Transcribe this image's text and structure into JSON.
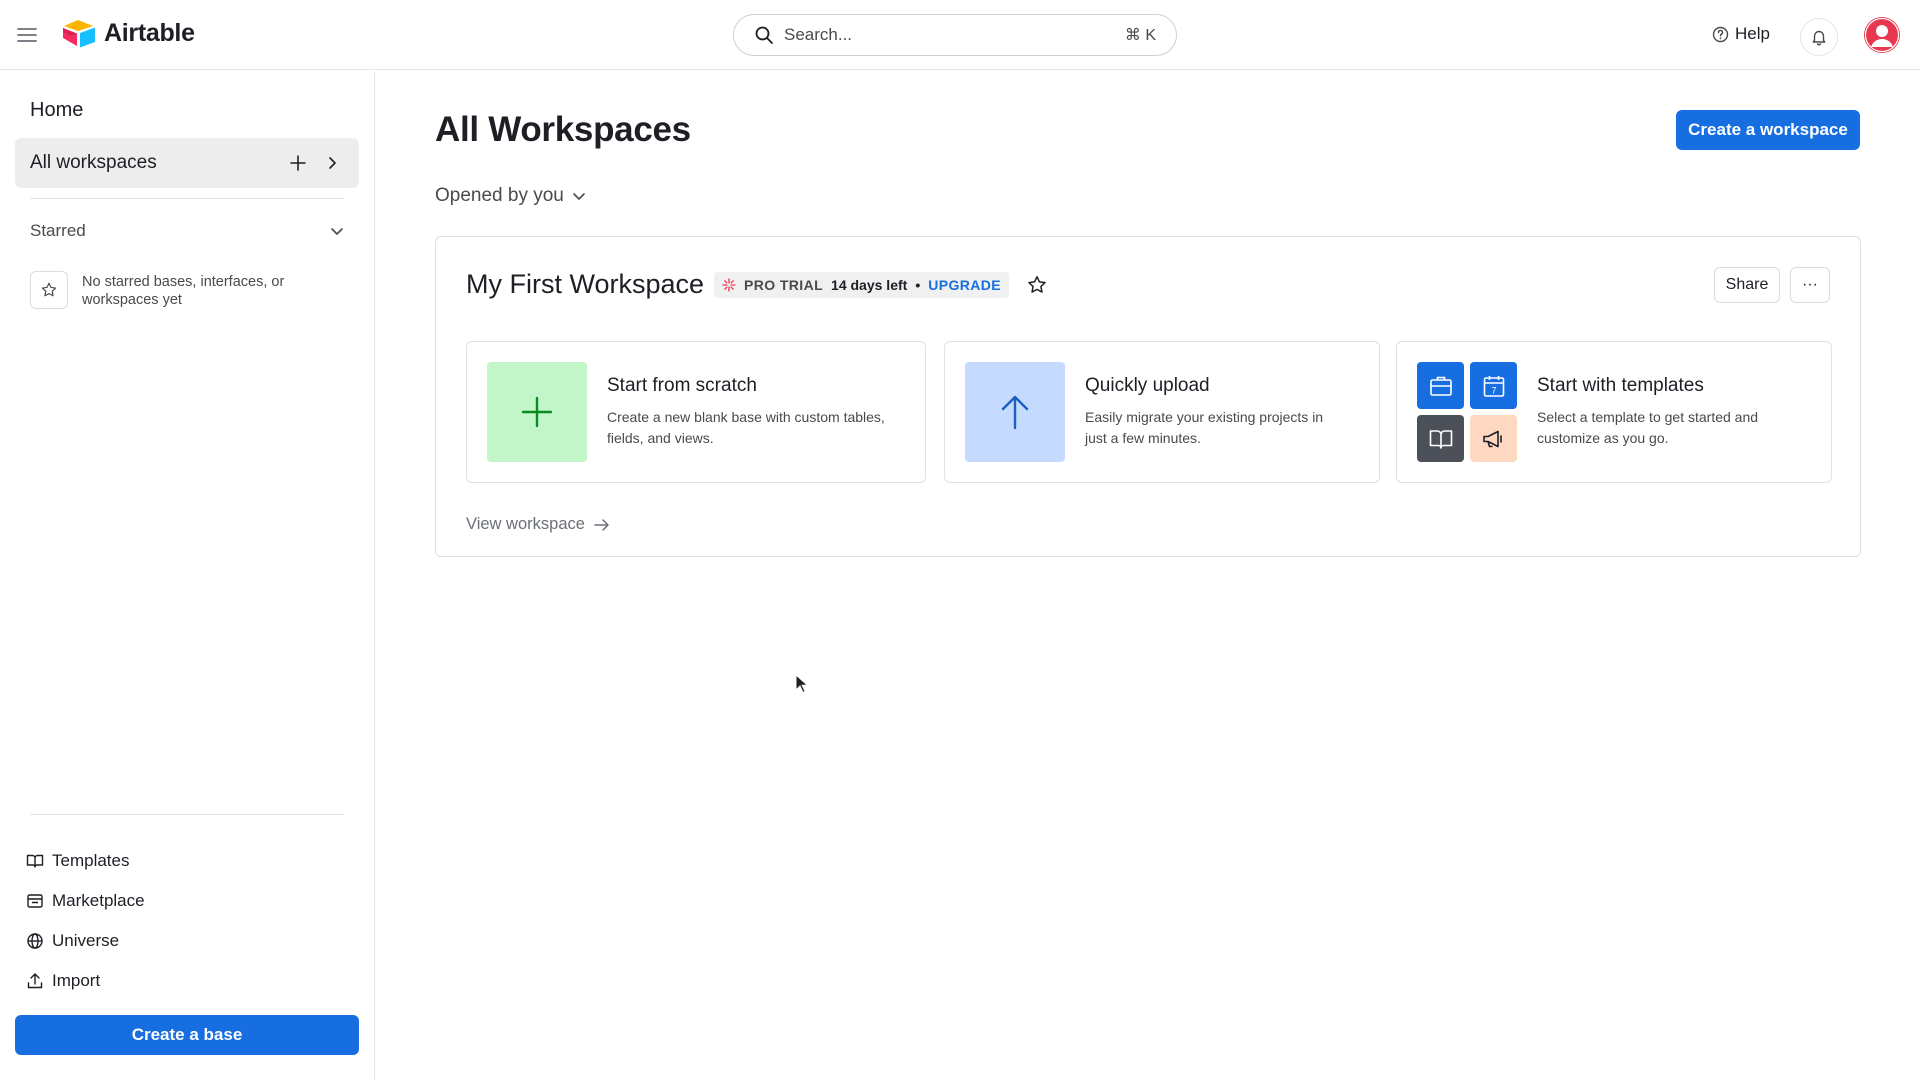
{
  "topbar": {
    "logo_text": "Airtable",
    "search_placeholder": "Search...",
    "search_shortcut": "⌘ K",
    "help_label": "Help"
  },
  "sidebar": {
    "home": "Home",
    "all_workspaces": "All workspaces",
    "starred": "Starred",
    "starred_empty": "No starred bases, interfaces, or workspaces yet",
    "links": [
      "Templates",
      "Marketplace",
      "Universe",
      "Import"
    ],
    "create_base": "Create a base"
  },
  "main": {
    "title": "All Workspaces",
    "create_workspace": "Create a workspace",
    "filter": "Opened by you",
    "workspace": {
      "name": "My First Workspace",
      "trial": {
        "label": "PRO TRIAL",
        "days_left": "14 days left",
        "separator": "•",
        "upgrade": "UPGRADE"
      },
      "share": "Share",
      "more": "···",
      "actions": [
        {
          "title": "Start from scratch",
          "desc_line1": "Create a new blank base with custom tables,",
          "desc_line2": "fields, and views."
        },
        {
          "title": "Quickly upload",
          "desc_line1": "Easily migrate your existing projects in",
          "desc_line2": "just a few minutes."
        },
        {
          "title": "Start with templates",
          "desc_line1": "Select a template to get started and",
          "desc_line2": "customize as you go."
        }
      ],
      "template_tile_day": "7",
      "view_workspace": "View workspace"
    }
  },
  "colors": {
    "accent": "#166ee1",
    "scratch_tile": "#c2f5c8",
    "upload_tile": "#c4daff",
    "avatar": "#e8384f"
  }
}
